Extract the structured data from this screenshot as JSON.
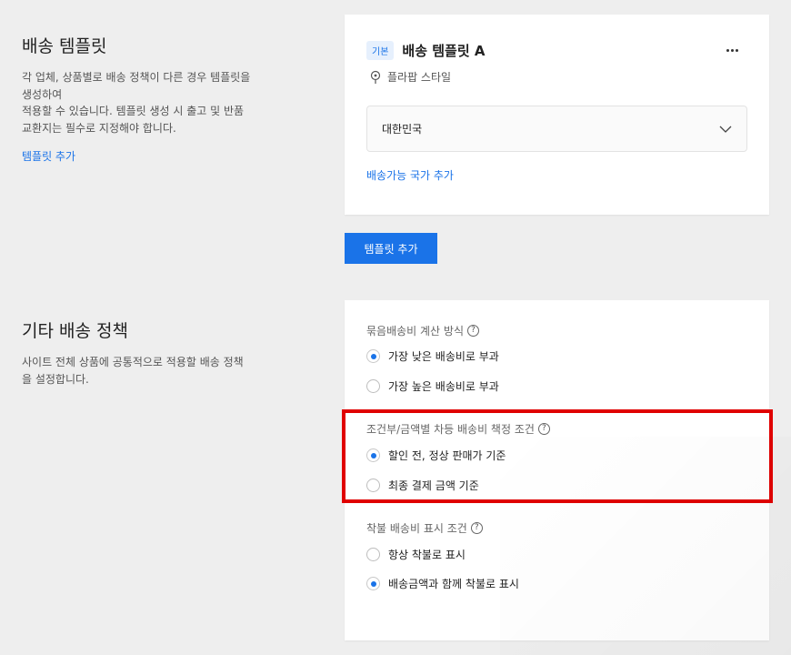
{
  "shipping_template": {
    "title": "배송 템플릿",
    "desc_line1": "각 업체, 상품별로 배송 정책이 다른 경우 템플릿을",
    "desc_line2": "생성하여",
    "desc_line3": "적용할 수 있습니다. 템플릿 생성 시 출고 및 반품",
    "desc_line4": "교환지는 필수로 지정해야 합니다.",
    "add_link": "템플릿 추가"
  },
  "template_card": {
    "badge": "기본",
    "name": "배송 템플릿 A",
    "style": "플라팝 스타일",
    "country": "대한민국",
    "add_country_link": "배송가능 국가 추가"
  },
  "add_template_button": "템플릿 추가",
  "other_policy": {
    "title": "기타 배송 정책",
    "desc_line1": "사이트 전체 상품에 공통적으로 적용할 배송 정책",
    "desc_line2": "을 설정합니다."
  },
  "policy_groups": {
    "bundle": {
      "label": "묶음배송비 계산 방식",
      "options": [
        "가장 낮은 배송비로 부과",
        "가장 높은 배송비로 부과"
      ],
      "selected": 0
    },
    "conditional": {
      "label": "조건부/금액별 차등 배송비 책정 조건",
      "options": [
        "할인 전, 정상 판매가 기준",
        "최종 결제 금액 기준"
      ],
      "selected": 0
    },
    "cod": {
      "label": "착불 배송비 표시 조건",
      "options": [
        "항상 착불로 표시",
        "배송금액과 함께 착불로 표시"
      ],
      "selected": 1
    }
  },
  "icons": {
    "help": "?",
    "accent_color": "#1a73e8",
    "highlight_color": "#e00000"
  }
}
